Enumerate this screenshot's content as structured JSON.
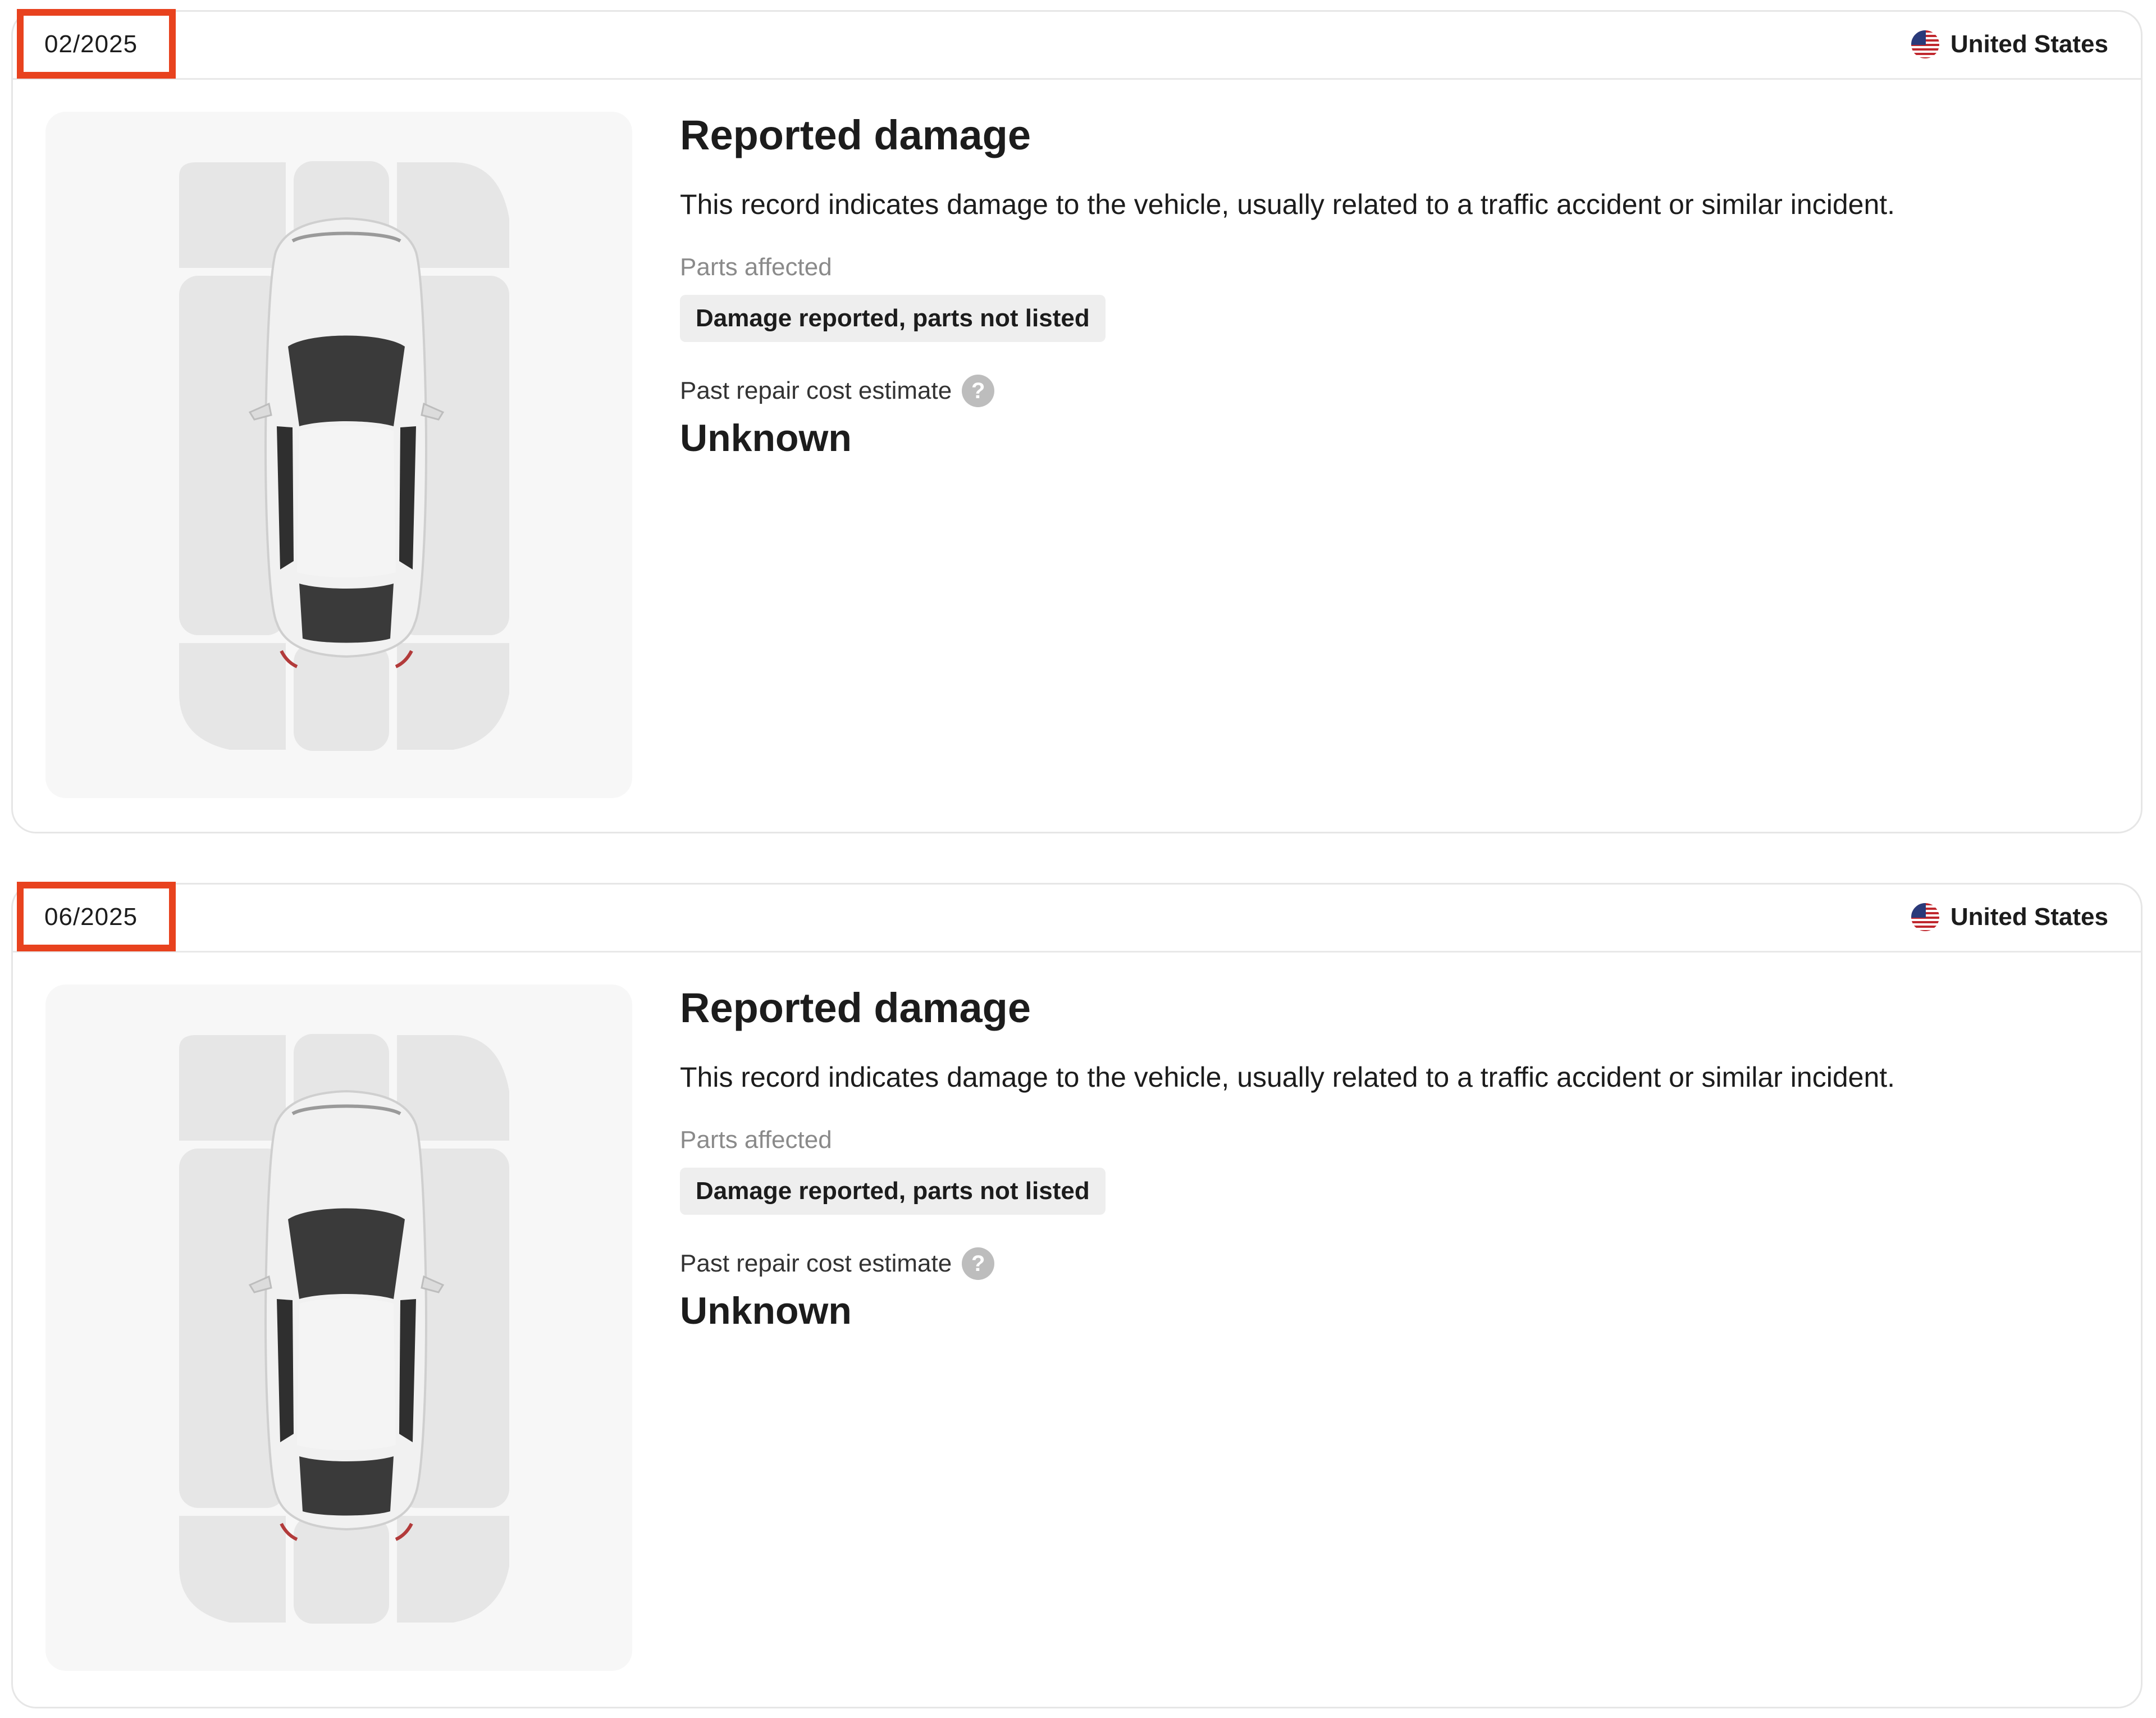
{
  "records": [
    {
      "date": "02/2025",
      "country": "United States",
      "title": "Reported damage",
      "description": "This record indicates damage to the vehicle, usually related to a traffic accident or similar incident.",
      "parts_label": "Parts affected",
      "parts_chip": "Damage reported, parts not listed",
      "cost_label": "Past repair cost estimate",
      "cost_help": "?",
      "cost_value": "Unknown"
    },
    {
      "date": "06/2025",
      "country": "United States",
      "title": "Reported damage",
      "description": "This record indicates damage to the vehicle, usually related to a traffic accident or similar incident.",
      "parts_label": "Parts affected",
      "parts_chip": "Damage reported, parts not listed",
      "cost_label": "Past repair cost estimate",
      "cost_help": "?",
      "cost_value": "Unknown"
    }
  ],
  "icons": {
    "flag": "us-flag-icon",
    "help": "question-circle-icon",
    "vehicle": "car-top-view-diagram"
  },
  "colors": {
    "highlight": "#e8421e",
    "border": "#e6e6e6",
    "panel": "#f7f7f7",
    "zone": "#e6e6e6"
  }
}
